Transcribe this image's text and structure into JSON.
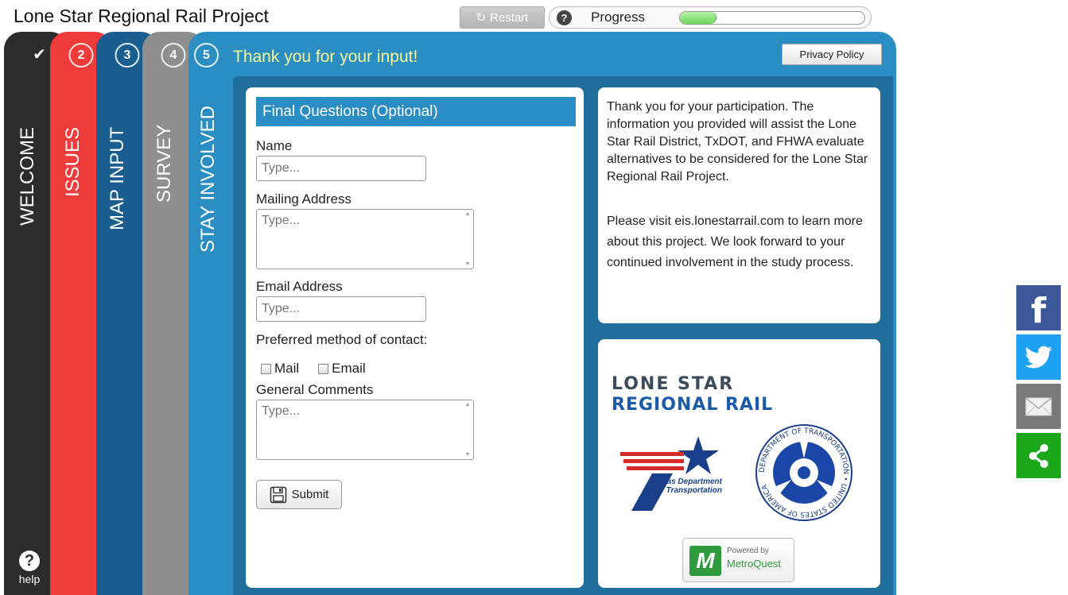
{
  "header": {
    "title": "Lone Star Regional Rail Project",
    "restart_label": "Restart",
    "progress_label": "Progress",
    "progress_fraction": 0.2
  },
  "tabs": [
    {
      "number": "✔",
      "label": "WELCOME",
      "color": "#2c2c2c"
    },
    {
      "number": "2",
      "label": "ISSUES",
      "color": "#f03b3b"
    },
    {
      "number": "3",
      "label": "MAP INPUT",
      "color": "#1a5e8f"
    },
    {
      "number": "4",
      "label": "SURVEY",
      "color": "#8f8f8f"
    },
    {
      "number": "5",
      "label": "STAY INVOLVED",
      "color": "#2b8ec2"
    }
  ],
  "help_label": "help",
  "panel": {
    "heading": "Thank you for your input!",
    "privacy_label": "Privacy Policy"
  },
  "form": {
    "title": "Final Questions (Optional)",
    "name_label": "Name",
    "name_placeholder": "Type...",
    "address_label": "Mailing Address",
    "address_placeholder": "Type...",
    "email_label": "Email Address",
    "email_placeholder": "Type...",
    "contact_label": "Preferred method of contact:",
    "contact_options": [
      "Mail",
      "Email"
    ],
    "comments_label": "General Comments",
    "comments_placeholder": "Type...",
    "submit_label": "Submit"
  },
  "info": {
    "paragraph1": "Thank you for your participation. The information you provided will assist the Lone Star Rail District, TxDOT, and FHWA evaluate alternatives to be considered for the Lone Star Regional Rail Project.",
    "paragraph2": "Please visit eis.lonestarrail.com to learn more about this project. We look forward to your continued involvement in the study process."
  },
  "logos": {
    "lsrr_line1": "LONE STAR",
    "lsrr_line2": "REGIONAL RAIL",
    "txdot_text": "Texas Department of Transportation",
    "usdot_ring_text": "DEPARTMENT OF TRANSPORTATION • UNITED STATES OF AMERICA",
    "metroquest_powered": "Powered by",
    "metroquest_name": "MetroQuest"
  },
  "share": {
    "icons": [
      "facebook-icon",
      "twitter-icon",
      "email-icon",
      "share-icon"
    ],
    "colors": {
      "facebook": "#3b5998",
      "twitter": "#1da1f2",
      "email": "#7a7a7a",
      "share": "#1aa71a"
    }
  }
}
